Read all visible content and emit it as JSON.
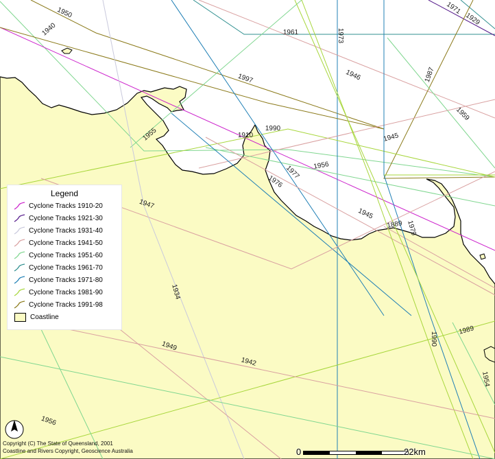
{
  "colors": {
    "land": "#fbfbc4",
    "sea": "#ffffff",
    "coast": "#000000",
    "decades": {
      "1910-20": "#cc22cc",
      "1921-30": "#551a8b",
      "1931-40": "#c9c9dc",
      "1941-50": "#d9a0a0",
      "1951-60": "#7fd68f",
      "1961-70": "#2f8f8f",
      "1971-80": "#1f7fb5",
      "1981-90": "#a7d63b",
      "1991-98": "#8b7a1a"
    }
  },
  "legend": {
    "title": "Legend",
    "items": [
      {
        "label": "Cyclone Tracks 1910-20",
        "color": "#cc22cc"
      },
      {
        "label": "Cyclone Tracks 1921-30",
        "color": "#551a8b"
      },
      {
        "label": "Cyclone Tracks 1931-40",
        "color": "#c9c9dc"
      },
      {
        "label": "Cyclone Tracks 1941-50",
        "color": "#d9a0a0"
      },
      {
        "label": "Cyclone Tracks 1951-60",
        "color": "#7fd68f"
      },
      {
        "label": "Cyclone Tracks 1961-70",
        "color": "#2f8f8f"
      },
      {
        "label": "Cyclone Tracks 1971-80",
        "color": "#1f7fb5"
      },
      {
        "label": "Cyclone Tracks 1981-90",
        "color": "#a7d63b"
      },
      {
        "label": "Cyclone Tracks 1991-98",
        "color": "#8b7a1a"
      }
    ],
    "coastline_label": "Coastline"
  },
  "track_labels": [
    "1950",
    "1940",
    "1971",
    "1929",
    "1961",
    "1973",
    "1997",
    "1946",
    "1987",
    "1959",
    "1955",
    "1910",
    "1990",
    "1945",
    "1956",
    "1977",
    "1976",
    "1945",
    "1889",
    "1979",
    "1947",
    "1934",
    "1989",
    "1990",
    "1949",
    "1942",
    "1954",
    "1956"
  ],
  "copyright": {
    "line1": "Copyright (C) The State of Queensland, 2001",
    "line2": "Coastline and Rivers Copyright, Geoscience Australia"
  },
  "scale": {
    "start": "0",
    "end": "22km"
  },
  "north_arrow": {
    "icon": "north-arrow-icon",
    "label": "N"
  }
}
